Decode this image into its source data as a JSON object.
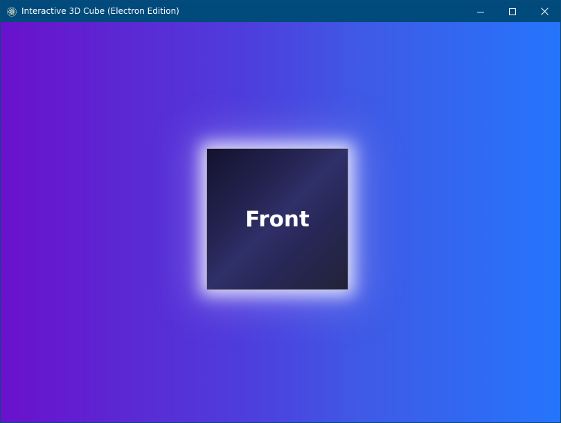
{
  "window": {
    "title": "Interactive 3D Cube (Electron Edition)",
    "icon": "electron-app-icon",
    "controls": [
      "minimize-icon",
      "maximize-icon",
      "close-icon"
    ]
  },
  "cube": {
    "visible_face_label": "Front"
  },
  "colors": {
    "titlebar": "#004a7c",
    "gradient_start": "#6a11cb",
    "gradient_end": "#2575fc",
    "face_dark": "#14122e",
    "face_text": "#ffffff"
  }
}
